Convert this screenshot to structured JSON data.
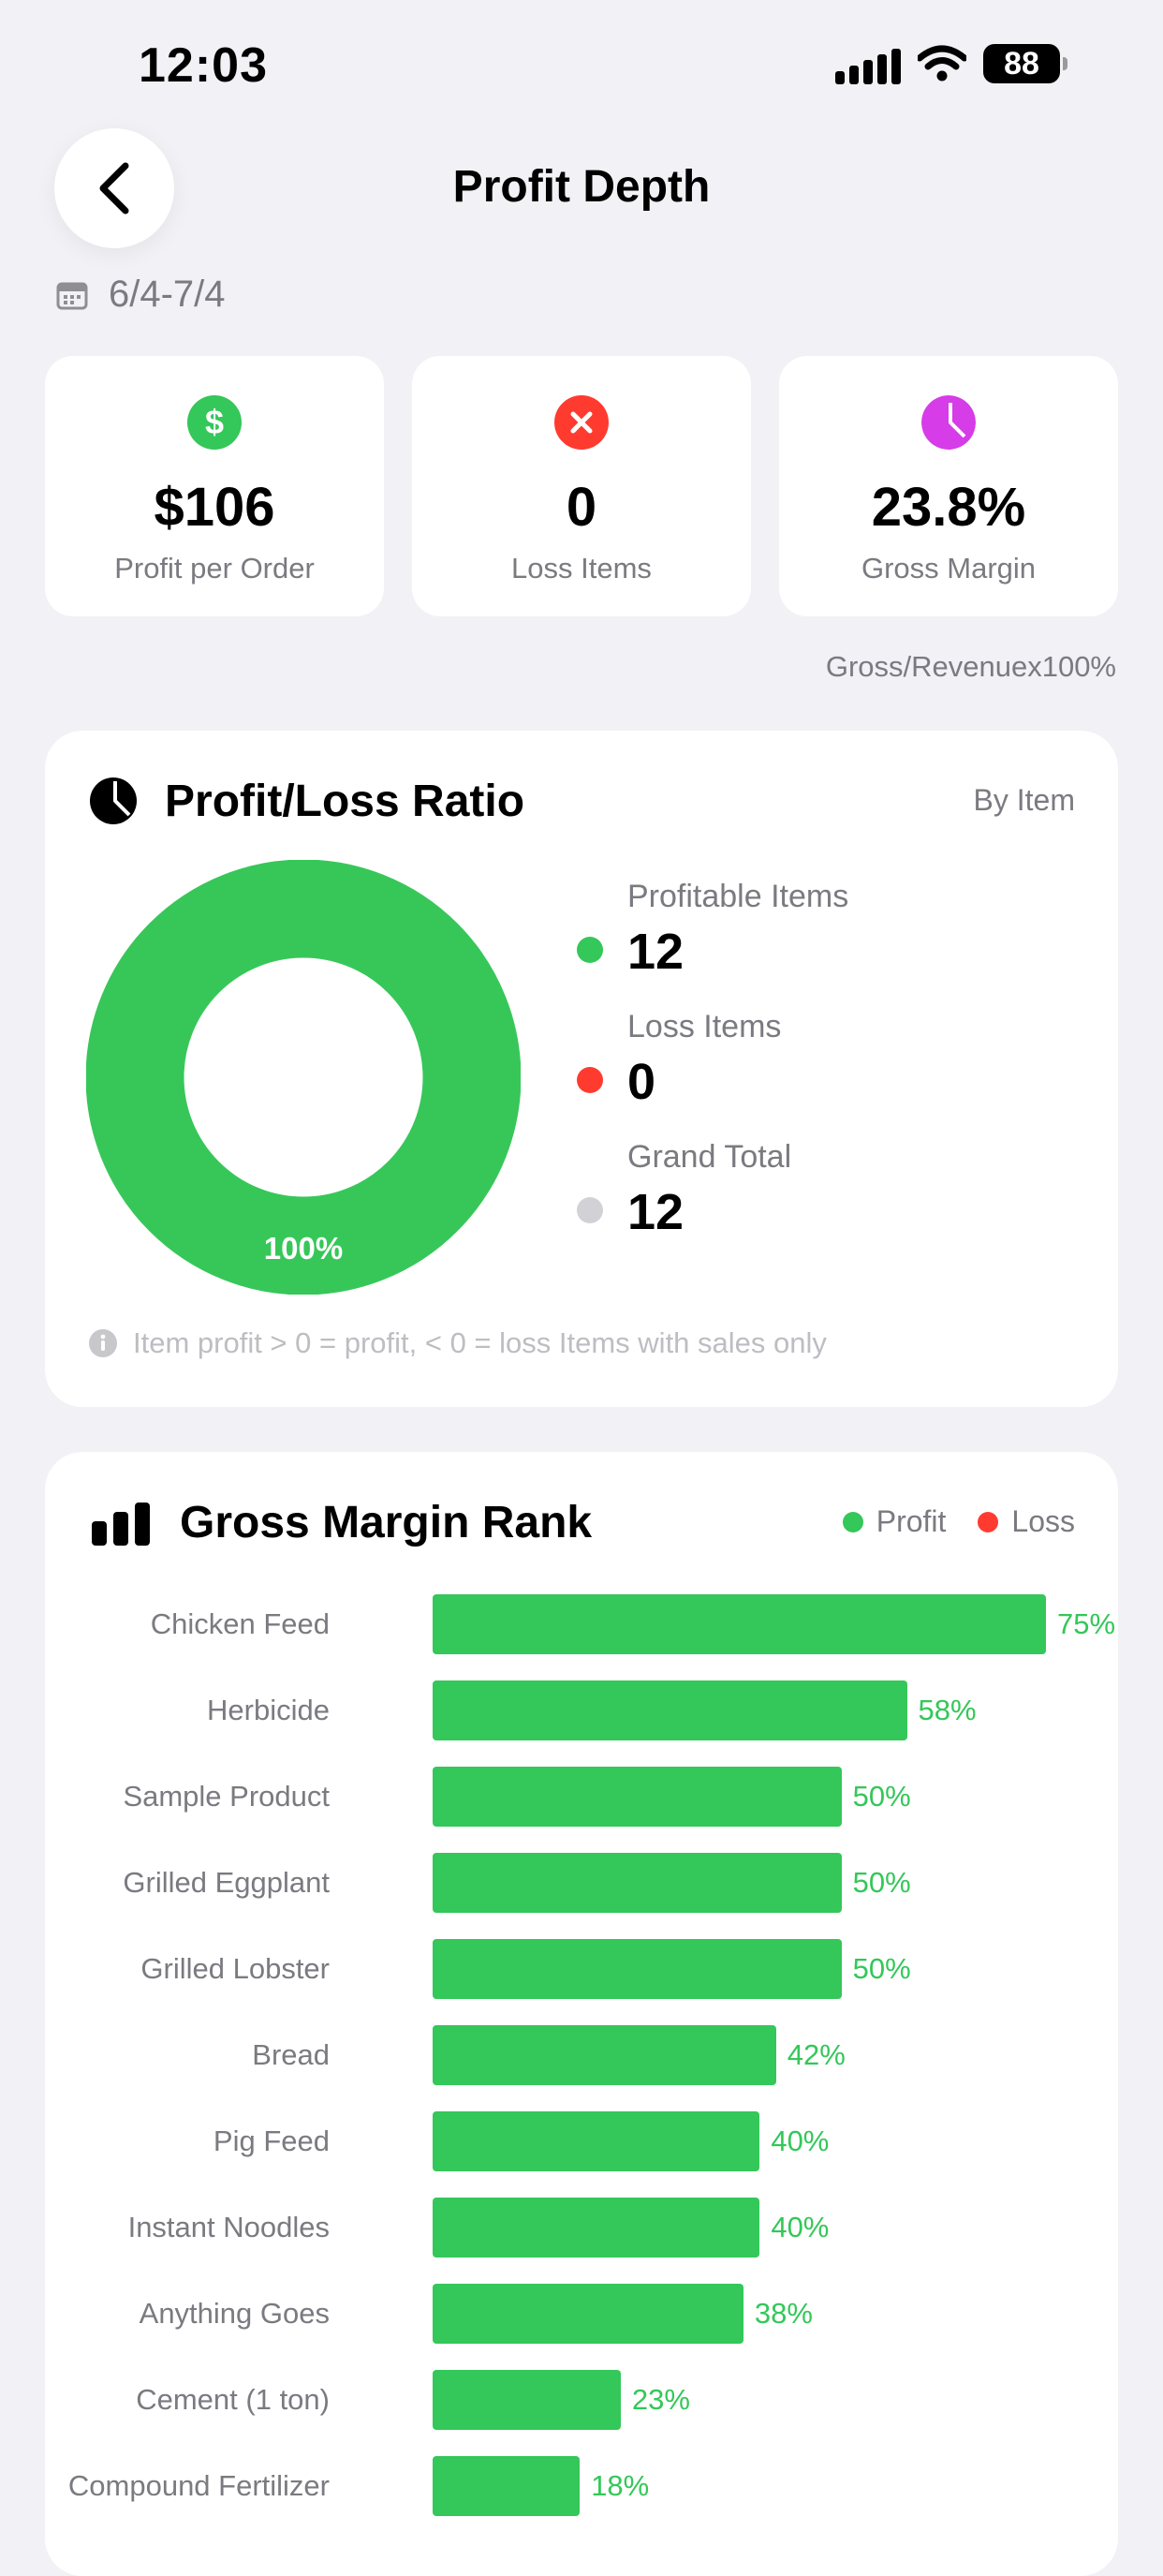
{
  "status_bar": {
    "time": "12:03",
    "battery": "88"
  },
  "header": {
    "title": "Profit Depth"
  },
  "date_range": "6/4-7/4",
  "stats": [
    {
      "value": "$106",
      "label": "Profit per Order",
      "icon": "dollar-icon",
      "color": "#34C759",
      "glyph": "$"
    },
    {
      "value": "0",
      "label": "Loss Items",
      "icon": "x-octagon-icon",
      "color": "#FF3B30",
      "glyph": "✕"
    },
    {
      "value": "23.8%",
      "label": "Gross Margin",
      "icon": "pie-icon",
      "color": "#D63CE8",
      "glyph": ""
    }
  ],
  "formula_note": "Gross/Revenuex100%",
  "ratio": {
    "title": "Profit/Loss Ratio",
    "by": "By Item",
    "donut_label": "100%",
    "legend": [
      {
        "label": "Profitable Items",
        "value": "12",
        "color": "#34C759"
      },
      {
        "label": "Loss Items",
        "value": "0",
        "color": "#FF3B30"
      },
      {
        "label": "Grand Total",
        "value": "12",
        "color": "#D1D1D6"
      }
    ],
    "note": "Item profit > 0 = profit, < 0 = loss  Items with sales only"
  },
  "rank": {
    "title": "Gross Margin Rank",
    "legend_profit": "Profit",
    "legend_loss": "Loss"
  },
  "chart_data": {
    "type": "bar",
    "orientation": "horizontal",
    "categories": [
      "Chicken Feed",
      "Herbicide",
      "Sample Product",
      "Grilled Eggplant",
      "Grilled Lobster",
      "Bread",
      "Pig Feed",
      "Instant Noodles",
      "Anything Goes",
      "Cement (1 ton)",
      "Compound Fertilizer"
    ],
    "values": [
      75,
      58,
      50,
      50,
      50,
      42,
      40,
      40,
      38,
      23,
      18
    ],
    "labels": [
      "75%",
      "58%",
      "50%",
      "50%",
      "50%",
      "42%",
      "40%",
      "40%",
      "38%",
      "23%",
      "18%"
    ],
    "series_color": "#34C759",
    "unit": "%"
  },
  "colors": {
    "profit": "#34C759",
    "loss": "#FF3B30",
    "background": "#F1F1F6"
  }
}
